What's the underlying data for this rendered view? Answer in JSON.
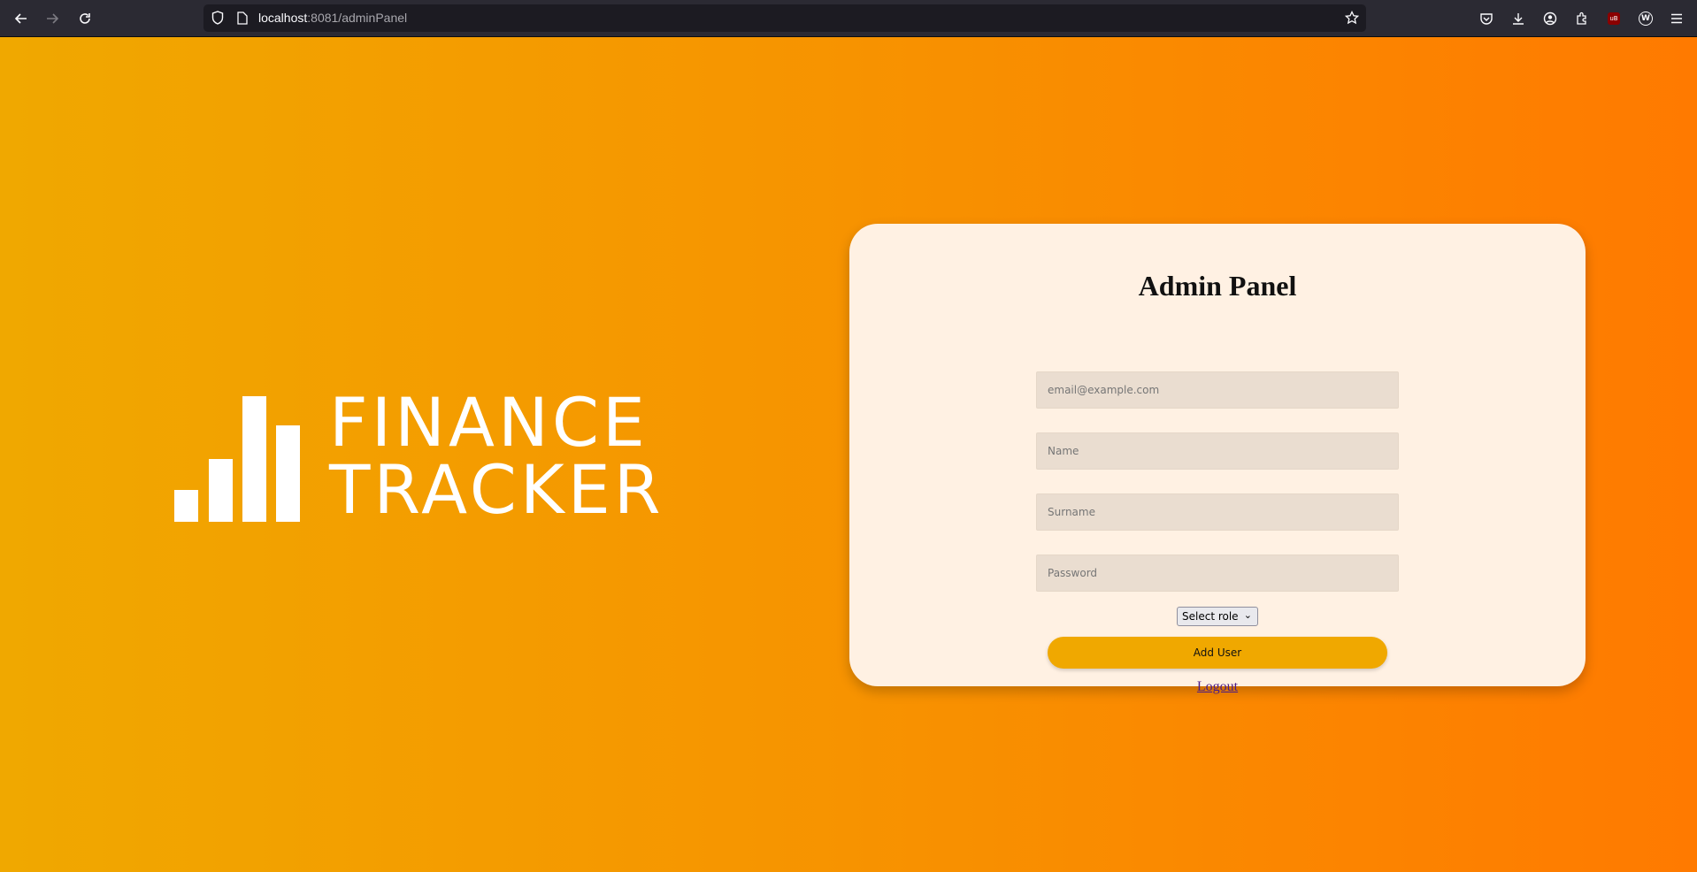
{
  "browser": {
    "url_host": "localhost",
    "url_path": ":8081/adminPanel",
    "icons": {
      "back": "back-icon",
      "forward": "forward-icon",
      "reload": "reload-icon",
      "shield": "shield-icon",
      "page": "page-icon",
      "bookmark": "star-icon",
      "pocket": "pocket-icon",
      "downloads": "download-icon",
      "account": "account-icon",
      "extensions": "extensions-icon",
      "ublock": "ublock-icon",
      "wappalyzer": "wappalyzer-icon",
      "menu": "menu-icon"
    },
    "ublock_label": "uB",
    "wappalyzer_label": "W"
  },
  "logo": {
    "line1": "FINANCE",
    "line2": "TRACKER",
    "bar_levels": [
      0.25,
      0.5,
      1.0,
      0.77
    ]
  },
  "admin_panel": {
    "title": "Admin Panel",
    "email_placeholder": "email@example.com",
    "name_placeholder": "Name",
    "surname_placeholder": "Surname",
    "password_placeholder": "Password",
    "role_select": "Select role",
    "add_button": "Add User",
    "logout_link": "Logout"
  },
  "colors": {
    "gradient_start": "#f0a800",
    "gradient_end": "#ff7a00",
    "card_bg": "#fff1e3",
    "button": "#f0a800"
  }
}
